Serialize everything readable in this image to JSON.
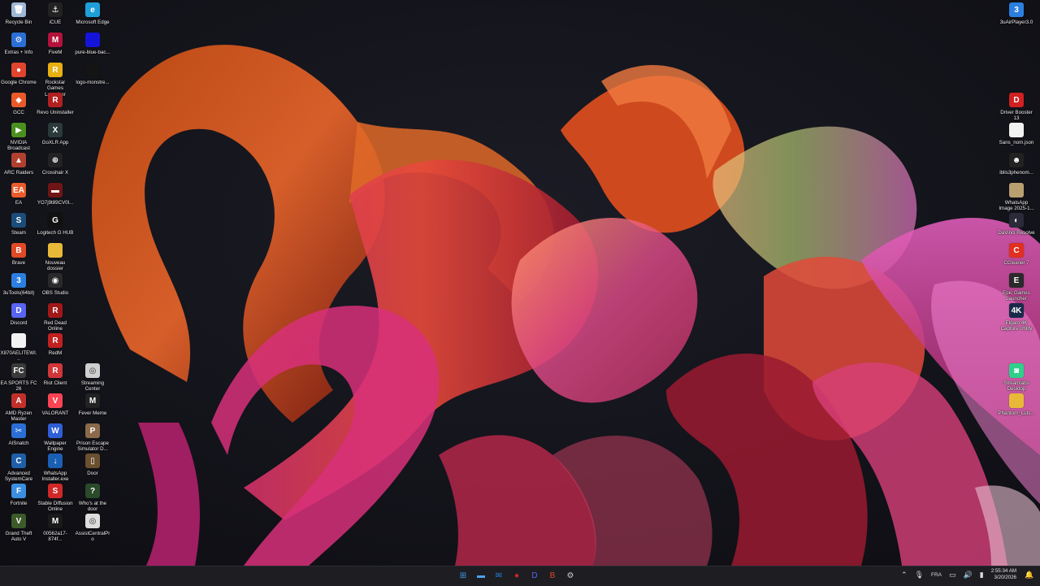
{
  "desktop": {
    "col1": [
      {
        "label": "Recycle Bin",
        "icon": "recycle-bin-icon",
        "color": "#9fb7d6",
        "glyph": "🗑"
      },
      {
        "label": "Extras + Info",
        "icon": "extras-info-icon",
        "color": "#2b6fd6",
        "glyph": "⚙"
      },
      {
        "label": "Google Chrome",
        "icon": "chrome-icon",
        "color": "#e0452f",
        "glyph": "●"
      },
      {
        "label": "GCC",
        "icon": "gcc-icon",
        "color": "#e85a2a",
        "glyph": "◆"
      },
      {
        "label": "NVIDIA Broadcast",
        "icon": "nvidia-icon",
        "color": "#4a8f1f",
        "glyph": "▶"
      },
      {
        "label": "ARC Raiders",
        "icon": "arc-raiders-icon",
        "color": "#b04030",
        "glyph": "▲"
      },
      {
        "label": "EA",
        "icon": "ea-icon",
        "color": "#ea5b2c",
        "glyph": "EA"
      },
      {
        "label": "Steam",
        "icon": "steam-icon",
        "color": "#1b4d7a",
        "glyph": "S"
      },
      {
        "label": "Brave",
        "icon": "brave-icon",
        "color": "#e04a26",
        "glyph": "B"
      },
      {
        "label": "3uTools(64bit)",
        "icon": "3utools-icon",
        "color": "#2b7fe0",
        "glyph": "3"
      },
      {
        "label": "Discord",
        "icon": "discord-icon",
        "color": "#5865f2",
        "glyph": "D"
      },
      {
        "label": "X870AELITEWI...",
        "icon": "document-icon",
        "color": "#f2f2f2",
        "glyph": ""
      },
      {
        "label": "EA SPORTS FC 26",
        "icon": "ea-fc-icon",
        "color": "#3a3a3a",
        "glyph": "FC"
      },
      {
        "label": "AMD Ryzen Master",
        "icon": "amd-icon",
        "color": "#c0302a",
        "glyph": "A"
      },
      {
        "label": "AISnatch",
        "icon": "aisnatch-icon",
        "color": "#2b6fd6",
        "glyph": "✂"
      },
      {
        "label": "Advanced SystemCare",
        "icon": "systemcare-icon",
        "color": "#1f5fa8",
        "glyph": "C"
      },
      {
        "label": "Fortnite",
        "icon": "fortnite-icon",
        "color": "#3b8ee0",
        "glyph": "F"
      },
      {
        "label": "Grand Theft Auto V",
        "icon": "gta-icon",
        "color": "#3d5a2a",
        "glyph": "V"
      }
    ],
    "col2": [
      {
        "label": "iCUE",
        "icon": "icue-icon",
        "color": "#222",
        "glyph": "⚓"
      },
      {
        "label": "FiveM",
        "icon": "fivem-icon",
        "color": "#b3123a",
        "glyph": "M"
      },
      {
        "label": "Rockstar Games Launcher",
        "icon": "rockstar-icon",
        "color": "#e8b010",
        "glyph": "R"
      },
      {
        "label": "Revo Uninstaller",
        "icon": "revo-icon",
        "color": "#b02020",
        "glyph": "R"
      },
      {
        "label": "GoXLR App",
        "icon": "goxlr-icon",
        "color": "#2a3a3a",
        "glyph": "X"
      },
      {
        "label": "Crosshair X",
        "icon": "crosshair-icon",
        "color": "#222",
        "glyph": "⊕"
      },
      {
        "label": "YO7j9t89CV0l...",
        "icon": "video-icon",
        "color": "#701515",
        "glyph": "▬"
      },
      {
        "label": "Logitech G HUB",
        "icon": "logitech-icon",
        "color": "#111",
        "glyph": "G"
      },
      {
        "label": "Nouveau dossier",
        "icon": "folder-icon",
        "color": "#e8b938",
        "glyph": ""
      },
      {
        "label": "OBS Studio",
        "icon": "obs-icon",
        "color": "#2a2a2a",
        "glyph": "◉"
      },
      {
        "label": "Red Dead Online",
        "icon": "rdr-icon",
        "color": "#a01818",
        "glyph": "R"
      },
      {
        "label": "RedM",
        "icon": "redm-icon",
        "color": "#c02020",
        "glyph": "R"
      },
      {
        "label": "Riot Client",
        "icon": "riot-icon",
        "color": "#d13639",
        "glyph": "R"
      },
      {
        "label": "VALORANT",
        "icon": "valorant-icon",
        "color": "#fa4454",
        "glyph": "V"
      },
      {
        "label": "Wallpaper Engine",
        "icon": "wallpaper-engine-icon",
        "color": "#2f5fd6",
        "glyph": "W"
      },
      {
        "label": "WhatsApp Installer.exe",
        "icon": "installer-icon",
        "color": "#1a5fb4",
        "glyph": "↓"
      },
      {
        "label": "Stable Diffusion Online",
        "icon": "stable-diffusion-icon",
        "color": "#d02828",
        "glyph": "S"
      },
      {
        "label": "00562a17-874f...",
        "icon": "monster-icon",
        "color": "#1a1a1a",
        "glyph": "M"
      }
    ],
    "col3": [
      {
        "label": "Microsoft Edge",
        "icon": "edge-icon",
        "color": "#1f9fd8",
        "glyph": "e"
      },
      {
        "label": "pure-blue-bac...",
        "icon": "image-icon",
        "color": "#1414d8",
        "glyph": ""
      },
      {
        "label": "logo-monstre...",
        "icon": "image-icon",
        "color": "#141414",
        "glyph": ""
      },
      {
        "label": "Streaming Center",
        "icon": "streaming-center-icon",
        "color": "#cfcfcf",
        "glyph": "◎"
      },
      {
        "label": "Fever Meme",
        "icon": "fever-meme-icon",
        "color": "#222",
        "glyph": "M"
      },
      {
        "label": "Prison Escape Simulator D...",
        "icon": "prison-escape-icon",
        "color": "#8a6a4a",
        "glyph": "P"
      },
      {
        "label": "Door",
        "icon": "door-icon",
        "color": "#6b5030",
        "glyph": "▯"
      },
      {
        "label": "Who's at the door",
        "icon": "whos-at-door-icon",
        "color": "#2a4a2a",
        "glyph": "?"
      },
      {
        "label": "AssistCentralPro",
        "icon": "assistcentral-icon",
        "color": "#ddd",
        "glyph": "◎"
      }
    ],
    "right": [
      {
        "label": "3uAirPlayer3.0",
        "icon": "airplayer-icon",
        "color": "#2b7fe0",
        "glyph": "3"
      },
      {
        "label": "Driver Booster 13",
        "icon": "driver-booster-icon",
        "color": "#d02020",
        "glyph": "D"
      },
      {
        "label": "Sans_nom.json",
        "icon": "document-icon",
        "color": "#f2f2f2",
        "glyph": ""
      },
      {
        "label": "iblis3phenom...",
        "icon": "image-icon",
        "color": "#222",
        "glyph": "☻"
      },
      {
        "label": "WhatsApp Image 2025-1...",
        "icon": "image-icon",
        "color": "#b8a070",
        "glyph": ""
      },
      {
        "label": "DaVinci Resolve",
        "icon": "davinci-icon",
        "color": "#2a2a3a",
        "glyph": "◐"
      },
      {
        "label": "CCleaner 7",
        "icon": "ccleaner-icon",
        "color": "#e03020",
        "glyph": "C"
      },
      {
        "label": "Epic Games Launcher",
        "icon": "epic-icon",
        "color": "#2a2a2a",
        "glyph": "E"
      },
      {
        "label": "Elgato 4K Capture Utility",
        "icon": "elgato-icon",
        "color": "#1a2a4a",
        "glyph": "4K"
      },
      {
        "label": "Streamlabs Desktop",
        "icon": "streamlabs-icon",
        "color": "#2fd08a",
        "glyph": "◙"
      },
      {
        "label": "Phantom_Luts...",
        "icon": "folder-icon",
        "color": "#e8b938",
        "glyph": ""
      }
    ]
  },
  "taskbar": {
    "apps": [
      {
        "icon": "windows-start-icon",
        "glyph": "⊞",
        "color": "#3b9cf0"
      },
      {
        "icon": "file-explorer-icon",
        "glyph": "▬",
        "color": "#4aa3f0"
      },
      {
        "icon": "mail-icon",
        "glyph": "✉",
        "color": "#2a7fd8"
      },
      {
        "icon": "recording-app-icon",
        "glyph": "●",
        "color": "#d02828"
      },
      {
        "icon": "discord-icon",
        "glyph": "D",
        "color": "#5865f2"
      },
      {
        "icon": "brave-icon",
        "glyph": "B",
        "color": "#e04a26"
      },
      {
        "icon": "settings-icon",
        "glyph": "⚙",
        "color": "#cccccc"
      }
    ],
    "tray": {
      "language": "FRA",
      "time": "2:55:34 AM",
      "date": "3/20/2026"
    }
  }
}
